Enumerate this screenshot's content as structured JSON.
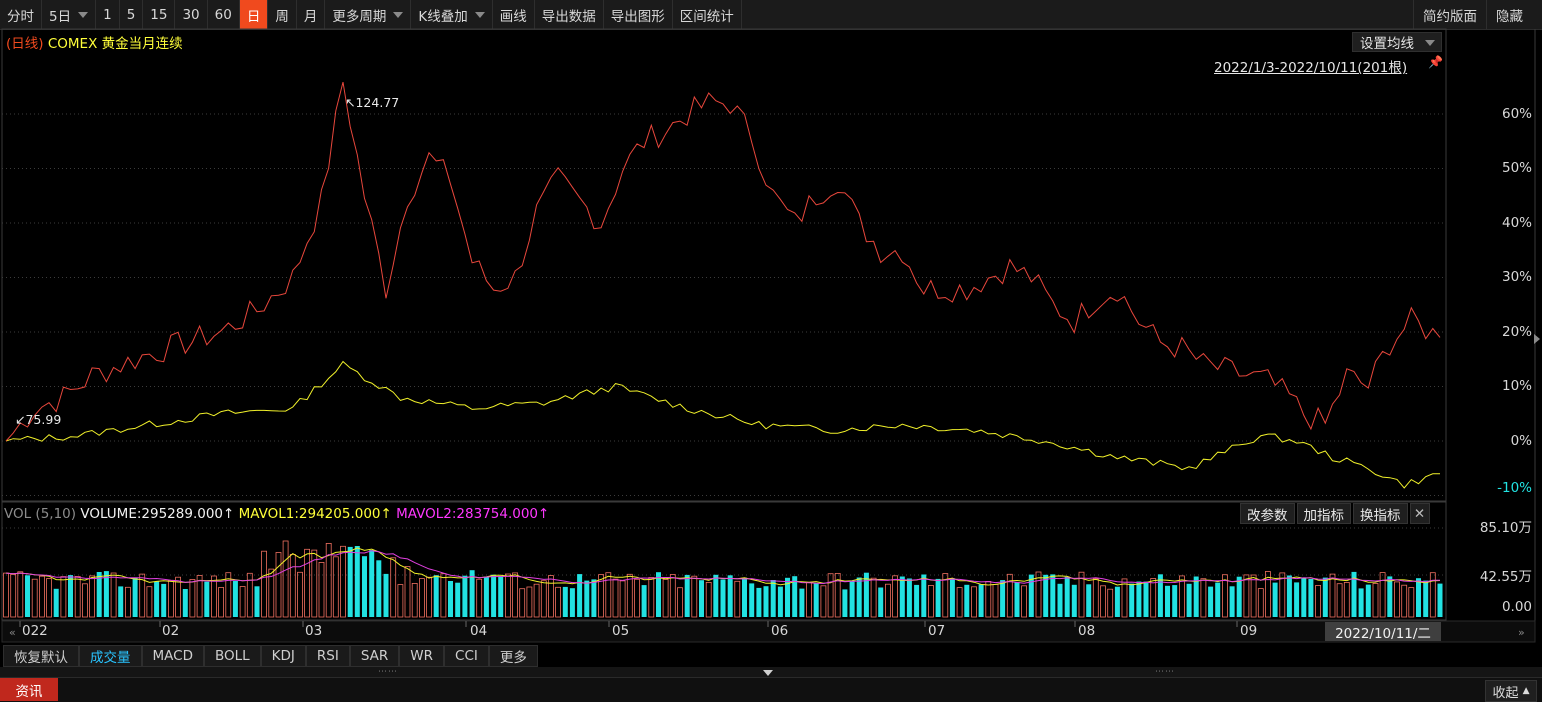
{
  "toolbar": {
    "items": [
      "分时",
      "5日",
      "1",
      "5",
      "15",
      "30",
      "60",
      "日",
      "周",
      "月",
      "更多周期",
      "K线叠加",
      "画线",
      "导出数据",
      "导出图形",
      "区间统计"
    ],
    "active": "日",
    "right_items": [
      "简约版面",
      "隐藏"
    ]
  },
  "chart": {
    "period_label": "(日线)",
    "instrument": "COMEX 黄金当月连续",
    "ma_button": "设置均线",
    "range_text": "2022/1/3-2022/10/11(201根)",
    "high_label": "124.77",
    "low_label": "75.99",
    "y_axis_labels": [
      "60%",
      "50%",
      "40%",
      "30%",
      "20%",
      "10%",
      "0%",
      "-10%"
    ]
  },
  "volume": {
    "label": "VOL (5,10)",
    "volume_text": "VOLUME:295289.000↑",
    "mavol1_text": "MAVOL1:294205.000↑",
    "mavol2_text": "MAVOL2:283754.000↑",
    "buttons": [
      "改参数",
      "加指标",
      "换指标"
    ],
    "y_axis_labels": [
      "85.10万",
      "42.55万",
      "0.00"
    ]
  },
  "x_axis": {
    "labels": [
      "022",
      "02",
      "03",
      "04",
      "05",
      "06",
      "07",
      "08",
      "09"
    ],
    "cursor_date": "2022/10/11/二"
  },
  "indicator_tabs": [
    "恢复默认",
    "成交量",
    "MACD",
    "BOLL",
    "KDJ",
    "RSI",
    "SAR",
    "WR",
    "CCI",
    "更多"
  ],
  "active_indicator": "成交量",
  "bottom": {
    "news": "资讯",
    "collapse": "收起"
  },
  "colors": {
    "price_line": "#e8473c",
    "overlay_line": "#f0f02a",
    "up_bar": "#f07060",
    "down_bar": "#22e2e2",
    "mavol1": "#f0f02a",
    "mavol2": "#e040e0",
    "accent": "#f04a1e"
  },
  "chart_data": {
    "type": "line",
    "y_unit": "%",
    "ylim": [
      -10,
      65
    ],
    "series": [
      {
        "name": "COMEX 黄金当月连续",
        "points": [
          [
            0,
            0
          ],
          [
            4,
            6
          ],
          [
            8,
            8
          ],
          [
            12,
            12
          ],
          [
            16,
            14
          ],
          [
            20,
            16
          ],
          [
            25,
            18
          ],
          [
            30,
            20
          ],
          [
            35,
            24
          ],
          [
            40,
            30
          ],
          [
            44,
            44
          ],
          [
            47,
            66
          ],
          [
            50,
            45
          ],
          [
            53,
            28
          ],
          [
            56,
            45
          ],
          [
            59,
            52
          ],
          [
            62,
            48
          ],
          [
            65,
            33
          ],
          [
            68,
            28
          ],
          [
            71,
            30
          ],
          [
            74,
            42
          ],
          [
            77,
            48
          ],
          [
            80,
            44
          ],
          [
            83,
            40
          ],
          [
            86,
            50
          ],
          [
            89,
            55
          ],
          [
            92,
            57
          ],
          [
            95,
            60
          ],
          [
            98,
            62
          ],
          [
            101,
            62
          ],
          [
            104,
            56
          ],
          [
            107,
            45
          ],
          [
            110,
            40
          ],
          [
            113,
            45
          ],
          [
            116,
            48
          ],
          [
            119,
            40
          ],
          [
            122,
            35
          ],
          [
            125,
            35
          ],
          [
            128,
            28
          ],
          [
            131,
            28
          ],
          [
            134,
            28
          ],
          [
            137,
            30
          ],
          [
            140,
            32
          ],
          [
            143,
            30
          ],
          [
            146,
            25
          ],
          [
            149,
            22
          ],
          [
            152,
            26
          ],
          [
            155,
            28
          ],
          [
            158,
            22
          ],
          [
            161,
            18
          ],
          [
            164,
            17
          ],
          [
            167,
            14
          ],
          [
            170,
            13
          ],
          [
            173,
            12
          ],
          [
            176,
            11
          ],
          [
            179,
            8
          ],
          [
            181,
            5
          ],
          [
            184,
            3
          ],
          [
            187,
            12
          ],
          [
            190,
            10
          ],
          [
            193,
            18
          ],
          [
            196,
            22
          ],
          [
            200,
            19
          ]
        ]
      },
      {
        "name": "overlay",
        "points": [
          [
            0,
            0
          ],
          [
            10,
            1
          ],
          [
            20,
            3
          ],
          [
            30,
            5
          ],
          [
            40,
            6
          ],
          [
            47,
            14
          ],
          [
            55,
            8
          ],
          [
            65,
            6
          ],
          [
            75,
            7
          ],
          [
            85,
            10
          ],
          [
            95,
            6
          ],
          [
            105,
            3
          ],
          [
            115,
            2
          ],
          [
            125,
            3
          ],
          [
            135,
            2
          ],
          [
            145,
            0
          ],
          [
            155,
            -3
          ],
          [
            165,
            -5
          ],
          [
            175,
            1
          ],
          [
            180,
            0
          ],
          [
            185,
            -3
          ],
          [
            190,
            -5
          ],
          [
            195,
            -8
          ],
          [
            200,
            -6
          ]
        ]
      }
    ]
  }
}
